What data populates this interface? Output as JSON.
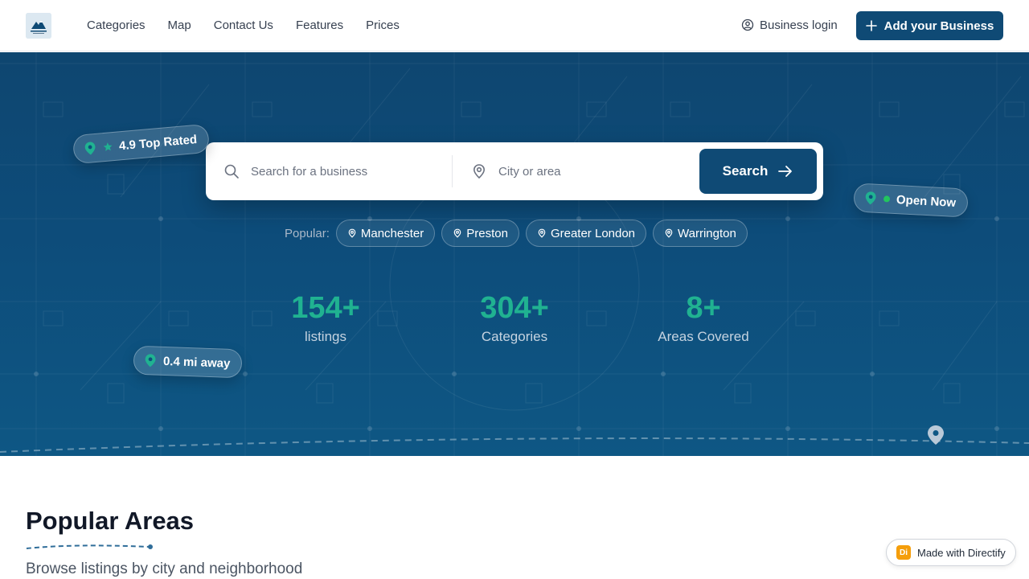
{
  "header": {
    "logo_icon": "logo-mountain-icon",
    "nav": [
      "Categories",
      "Map",
      "Contact Us",
      "Features",
      "Prices"
    ],
    "login_label": "Business login",
    "add_business_label": "Add your Business"
  },
  "hero": {
    "search_placeholder": "Search for a business",
    "city_placeholder": "City or area",
    "search_button": "Search",
    "popular_label": "Popular:",
    "popular_chips": [
      "Manchester",
      "Preston",
      "Greater London",
      "Warrington"
    ],
    "stats": [
      {
        "value": "154+",
        "label": "listings"
      },
      {
        "value": "304+",
        "label": "Categories"
      },
      {
        "value": "8+",
        "label": "Areas Covered"
      }
    ],
    "badges": {
      "top_rated": "4.9 Top Rated",
      "open_now": "Open Now",
      "distance": "0.4 mi away"
    }
  },
  "section": {
    "title": "Popular Areas",
    "subtitle": "Browse listings by city and neighborhood"
  },
  "footer_badge": {
    "logo_text": "Di",
    "label": "Made with Directify"
  },
  "colors": {
    "primary": "#0f4a75",
    "accent": "#20b291",
    "hero_bg": "#0d4c7a"
  }
}
